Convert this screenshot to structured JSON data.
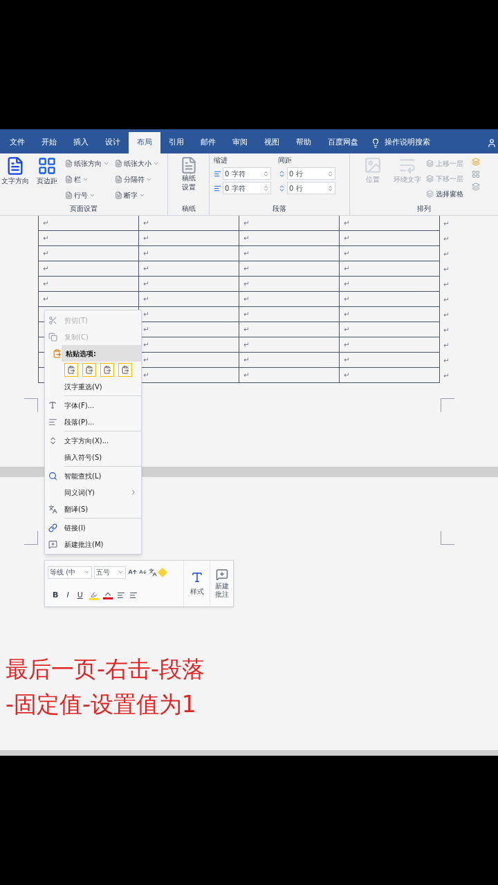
{
  "tabs": [
    {
      "label": "文件",
      "selected": false
    },
    {
      "label": "开始",
      "selected": false
    },
    {
      "label": "插入",
      "selected": false
    },
    {
      "label": "设计",
      "selected": false
    },
    {
      "label": "布局",
      "selected": true
    },
    {
      "label": "引用",
      "selected": false
    },
    {
      "label": "邮件",
      "selected": false
    },
    {
      "label": "审阅",
      "selected": false
    },
    {
      "label": "视图",
      "selected": false
    },
    {
      "label": "帮助",
      "selected": false
    },
    {
      "label": "百度网盘",
      "selected": false
    }
  ],
  "tell_me": "操作说明搜索",
  "page_setup": {
    "big": [
      "文字方向",
      "页边距"
    ],
    "small": [
      "纸张方向",
      "纸张大小",
      "栏",
      "分隔符",
      "行号",
      "断字"
    ],
    "title": "页面设置"
  },
  "draft": {
    "button": "稿纸设置",
    "title": "稿纸"
  },
  "paragraph": {
    "indent_label": "缩进",
    "spacing_label": "间距",
    "indent": [
      "0 字符",
      "0 字符"
    ],
    "spacing": [
      "0 行",
      "0 行"
    ],
    "title": "段落"
  },
  "arrange": {
    "big": [
      "位置",
      "环绕文字"
    ],
    "small": [
      "上移一层",
      "下移一层",
      "选择窗格"
    ],
    "disabled": [
      true,
      true,
      true,
      true,
      false
    ],
    "title": "排列"
  },
  "table": {
    "rows": [
      [
        "↵",
        "↵",
        "↵",
        "↵",
        "↵"
      ],
      [
        "↵",
        "↵",
        "↵",
        "↵",
        "↵"
      ],
      [
        "↵",
        "↵",
        "↵",
        "↵",
        "↵"
      ],
      [
        "↵",
        "↵",
        "↵",
        "↵",
        "↵"
      ],
      [
        "↵",
        "↵",
        "↵",
        "↵",
        "↵"
      ],
      [
        "↵",
        "↵",
        "↵",
        "↵",
        "↵"
      ],
      [
        null,
        "↵",
        "↵",
        "↵",
        "↵"
      ],
      [
        null,
        "↵",
        "↵",
        "↵",
        "↵"
      ],
      [
        null,
        "↵",
        "↵",
        "↵",
        "↵"
      ],
      [
        null,
        "↵",
        "↵",
        "↵",
        "↵"
      ],
      [
        null,
        "↵",
        "↵",
        "↵",
        "↵"
      ]
    ]
  },
  "context_menu": [
    {
      "kind": "item",
      "label": "剪切(T)",
      "disabled": true
    },
    {
      "kind": "item",
      "label": "复制(C)",
      "disabled": true
    },
    {
      "kind": "header",
      "label": "粘贴选项:",
      "disabled": false
    },
    {
      "kind": "paste"
    },
    {
      "kind": "item",
      "label": "汉字重选(V)",
      "disabled": false
    },
    {
      "kind": "item",
      "label": "字体(F)...",
      "disabled": false
    },
    {
      "kind": "item",
      "label": "段落(P)...",
      "disabled": false
    },
    {
      "kind": "item",
      "label": "文字方向(X)...",
      "disabled": false
    },
    {
      "kind": "item",
      "label": "插入符号(S)",
      "disabled": false
    },
    {
      "kind": "item",
      "label": "智能查找(L)",
      "disabled": false
    },
    {
      "kind": "submenu",
      "label": "同义词(Y)",
      "disabled": false
    },
    {
      "kind": "item",
      "label": "翻译(S)",
      "disabled": false
    },
    {
      "kind": "item",
      "label": "链接(I)",
      "disabled": false
    },
    {
      "kind": "item",
      "label": "新建批注(M)",
      "disabled": false
    }
  ],
  "mini_toolbar": {
    "font": "等线 (中",
    "size": "五号",
    "styles": "样式",
    "comment": "新建批注",
    "format": [
      "B",
      "I",
      "U"
    ]
  },
  "caption": [
    "最后一页-右击-段落",
    "-固定值-设置值为1"
  ]
}
